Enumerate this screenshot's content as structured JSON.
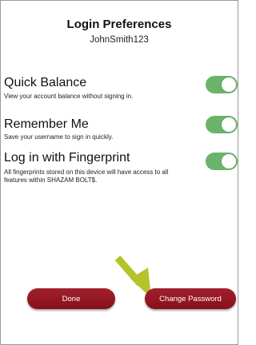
{
  "header": {
    "title": "Login Preferences",
    "username": "JohnSmith123"
  },
  "preferences": [
    {
      "label": "Quick Balance",
      "description": "View your account balance without signing in.",
      "enabled": true
    },
    {
      "label": "Remember Me",
      "description": "Save your username to sign in quickly.",
      "enabled": true
    },
    {
      "label": "Log in with Fingerprint",
      "description": "All fingerprints stored on this device will have access to all features within SHAZAM BOLT$.",
      "enabled": true
    }
  ],
  "buttons": {
    "done": "Done",
    "change_password": "Change Password"
  },
  "colors": {
    "toggle_on": "#6ab36a",
    "button": "#8f0e1b",
    "annotation_arrow": "#b7c32b"
  }
}
